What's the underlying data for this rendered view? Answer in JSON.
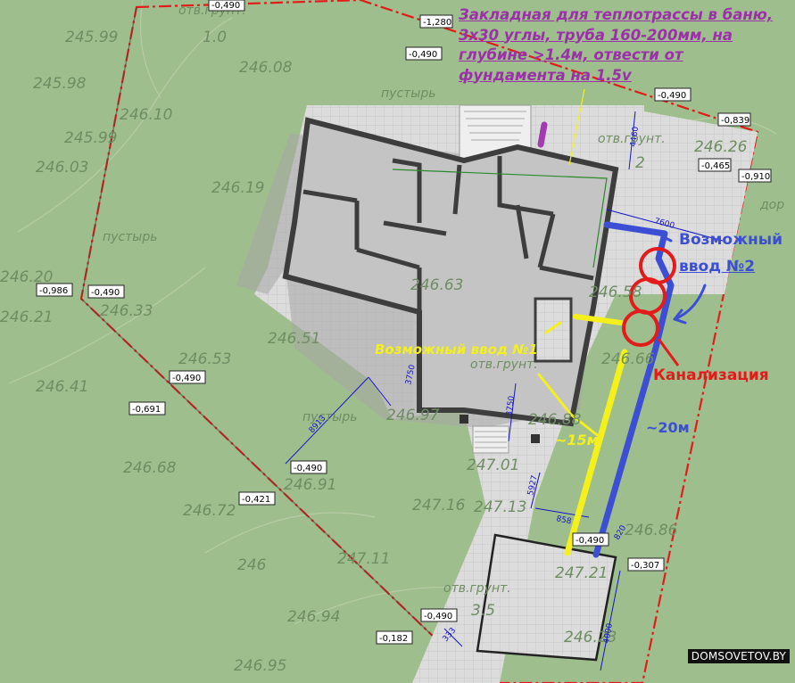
{
  "annotations": {
    "note": "Закладная для теплотрассы в баню, 3х30 углы, труба 160-200мм, на глубине >1.4м, отвести от фундамента на 1.5v",
    "entry1": "Возможный ввод №1",
    "entry2_line1": "Возможный",
    "entry2_line2": "ввод №2",
    "sewer": "Канализация",
    "dist_yellow": "~15м",
    "dist_blue": "~20м",
    "watermark": "DOMSOVETOV.BY"
  },
  "colors": {
    "grass": "#9fbe8e",
    "paving": "#d8d8d8",
    "walls": "#3d3d3d",
    "yellow_route": "#f5f01c",
    "blue_route": "#3c4fd4",
    "red_boundary": "#e21b1b",
    "note_purple": "#9b31a8"
  },
  "elevations": [
    "245.99",
    "1.0",
    "246.08",
    "245.98",
    "246.10",
    "245.99",
    "246.03",
    "246.19",
    "246.20",
    "246.21",
    "246.33",
    "246.41",
    "246.51",
    "246.53",
    "246.63",
    "246.58",
    "246.68",
    "246.91",
    "246.72",
    "246",
    "246.94",
    "246.95",
    "247.01",
    "247.16",
    "247.13",
    "247.11",
    "247.21",
    "246.86",
    "246.23",
    "246.26",
    "246.88",
    "246.97",
    "3.5",
    "246.66",
    "2"
  ],
  "terrain_labels": [
    "пустырь",
    "пустырь",
    "пустырь",
    "отв.грунт.",
    "отв.грунт.",
    "отв.грунт.",
    "отв.грунт.",
    "дор"
  ],
  "level_tags": [
    "-1,280",
    "-0,490",
    "-0,490",
    "-0,839",
    "-0,465",
    "-0,910",
    "-0,986",
    "-0,490",
    "-0,490",
    "-0,691",
    "-0,490",
    "-0,421",
    "-0,490",
    "-0,307",
    "-0,490",
    "-0,182",
    "-0,490"
  ],
  "dimensions": [
    "4460",
    "7600",
    "3750",
    "3750",
    "8913",
    "5927",
    "858",
    "4000",
    "820",
    "333"
  ]
}
